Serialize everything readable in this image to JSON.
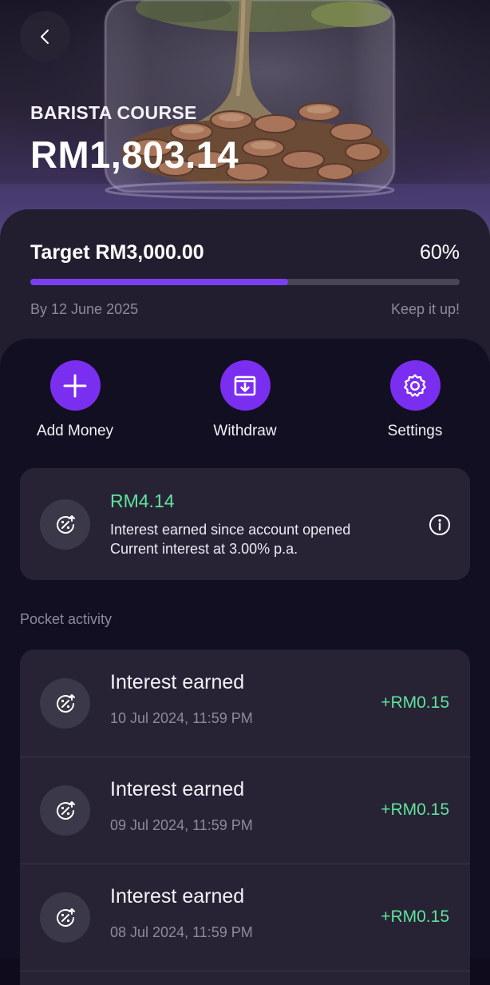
{
  "header": {
    "back_icon": "chevron-left-icon",
    "pocket_name": "BARISTA COURSE",
    "balance": "RM1,803.14"
  },
  "target": {
    "label": "Target RM3,000.00",
    "percent_label": "60%",
    "progress_percent": 60,
    "date_label": "By 12 June 2025",
    "encouragement": "Keep it up!",
    "accent_color": "#7b3ff2"
  },
  "actions": [
    {
      "label": "Add Money",
      "icon": "plus-icon"
    },
    {
      "label": "Withdraw",
      "icon": "withdraw-tray-icon"
    },
    {
      "label": "Settings",
      "icon": "gear-icon"
    }
  ],
  "interest": {
    "amount": "RM4.14",
    "line1": "Interest earned since account opened",
    "line2": "Current interest at 3.00% p.a.",
    "icon": "interest-percent-icon",
    "info_icon": "info-icon",
    "amount_color": "#5fe39a"
  },
  "activity": {
    "section_title": "Pocket activity",
    "items": [
      {
        "title": "Interest earned",
        "date": "10 Jul 2024, 11:59 PM",
        "amount": "+RM0.15"
      },
      {
        "title": "Interest earned",
        "date": "09 Jul 2024, 11:59 PM",
        "amount": "+RM0.15"
      },
      {
        "title": "Interest earned",
        "date": "08 Jul 2024, 11:59 PM",
        "amount": "+RM0.15"
      }
    ]
  }
}
